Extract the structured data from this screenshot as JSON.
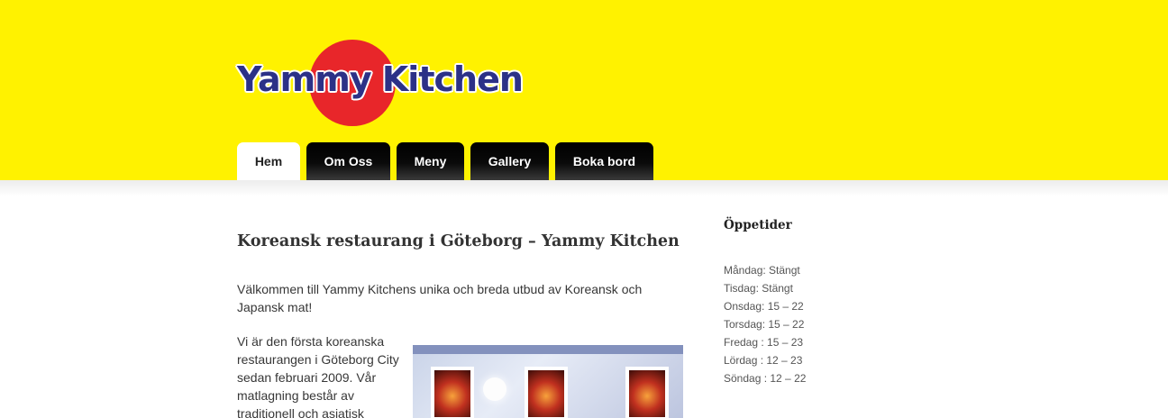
{
  "header": {
    "logo_text": "Yammy Kitchen",
    "background_color": "#fff200",
    "logo_circle_color": "#e8262a",
    "logo_text_color": "#2c3187"
  },
  "nav": {
    "items": [
      {
        "label": "Hem",
        "active": true
      },
      {
        "label": "Om Oss",
        "active": false
      },
      {
        "label": "Meny",
        "active": false
      },
      {
        "label": "Gallery",
        "active": false
      },
      {
        "label": "Boka bord",
        "active": false
      }
    ]
  },
  "main": {
    "title": "Koreansk restaurang i Göteborg – Yammy Kitchen",
    "intro": "Välkommen till Yammy Kitchens unika och breda utbud av Koreansk och Japansk mat!",
    "paragraph2": "Vi är den första koreanska restaurangen i Göteborg City sedan februari 2009. Vår matlagning består av traditionell och asiatisk",
    "photo_icon": "restaurant-facade-photo"
  },
  "sidebar": {
    "title": "Öppetider",
    "hours": [
      "Måndag: Stängt",
      "Tisdag: Stängt",
      "Onsdag: 15 – 22",
      "Torsdag: 15 – 22",
      "Fredag : 15 – 23",
      "Lördag : 12 – 23",
      "Söndag : 12 – 22"
    ]
  }
}
